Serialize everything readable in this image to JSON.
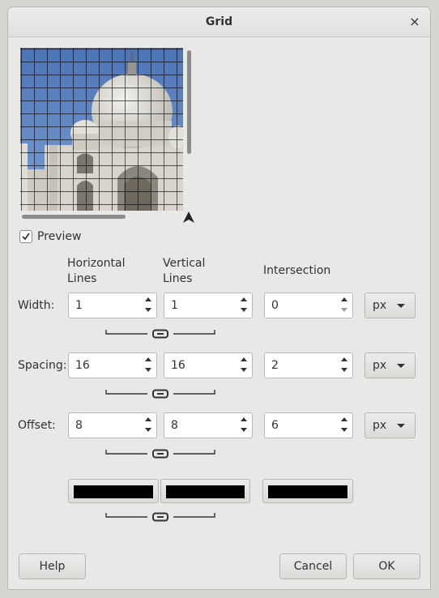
{
  "dialog": {
    "title": "Grid",
    "close_glyph": "×"
  },
  "preview": {
    "label": "Preview",
    "checked": true
  },
  "columns": {
    "horizontal": [
      "Horizontal",
      "Lines"
    ],
    "vertical": [
      "Vertical",
      "Lines"
    ],
    "intersection": "Intersection"
  },
  "rows": {
    "width": {
      "label": "Width:",
      "horizontal": "1",
      "vertical": "1",
      "intersection": "0",
      "unit": "px"
    },
    "spacing": {
      "label": "Spacing:",
      "horizontal": "16",
      "vertical": "16",
      "intersection": "2",
      "unit": "px"
    },
    "offset": {
      "label": "Offset:",
      "horizontal": "8",
      "vertical": "8",
      "intersection": "6",
      "unit": "px"
    }
  },
  "colors": {
    "horizontal": "#000000",
    "vertical": "#000000",
    "intersection": "#000000"
  },
  "buttons": {
    "help": "Help",
    "cancel": "Cancel",
    "ok": "OK"
  }
}
